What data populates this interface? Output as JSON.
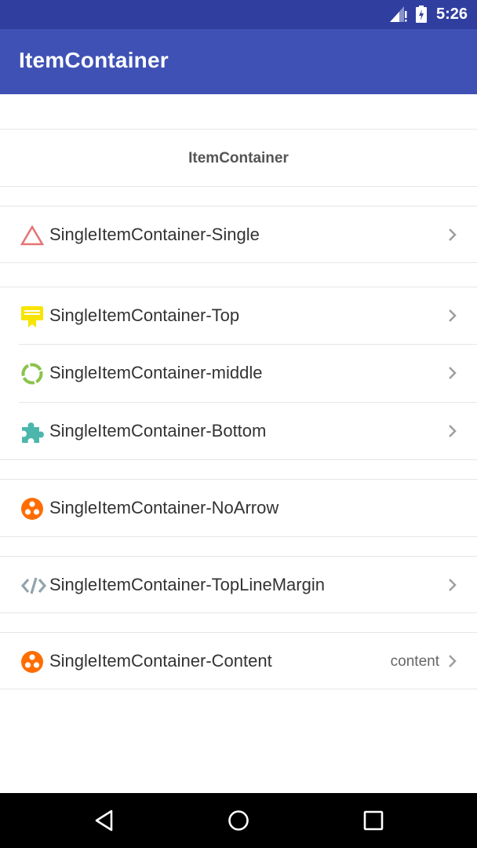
{
  "status_bar": {
    "time": "5:26",
    "signal_icon": "signal-icon",
    "battery_icon": "battery-icon"
  },
  "app_bar": {
    "title": "ItemContainer"
  },
  "header": {
    "text": "ItemContainer"
  },
  "items": [
    {
      "label": "SingleItemContainer-Single",
      "icon": "triangle-icon",
      "icon_color": "#e57373",
      "arrow": true,
      "value": ""
    },
    {
      "label": "SingleItemContainer-Top",
      "icon": "certificate-icon",
      "icon_color": "#f9e400",
      "arrow": true,
      "value": ""
    },
    {
      "label": "SingleItemContainer-middle",
      "icon": "dashed-circle-icon",
      "icon_color": "#8bc34a",
      "arrow": true,
      "value": ""
    },
    {
      "label": "SingleItemContainer-Bottom",
      "icon": "puzzle-icon",
      "icon_color": "#4db6ac",
      "arrow": true,
      "value": ""
    },
    {
      "label": "SingleItemContainer-NoArrow",
      "icon": "three-dots-circle-icon",
      "icon_color": "#ff6d00",
      "arrow": false,
      "value": ""
    },
    {
      "label": "SingleItemContainer-TopLineMargin",
      "icon": "code-icon",
      "icon_color": "#90a4ae",
      "arrow": true,
      "value": ""
    },
    {
      "label": "SingleItemContainer-Content",
      "icon": "three-dots-circle-icon",
      "icon_color": "#ff6d00",
      "arrow": true,
      "value": "content"
    }
  ],
  "nav_bar": {
    "back_icon": "back-icon",
    "home_icon": "home-icon",
    "recents_icon": "recents-icon"
  }
}
